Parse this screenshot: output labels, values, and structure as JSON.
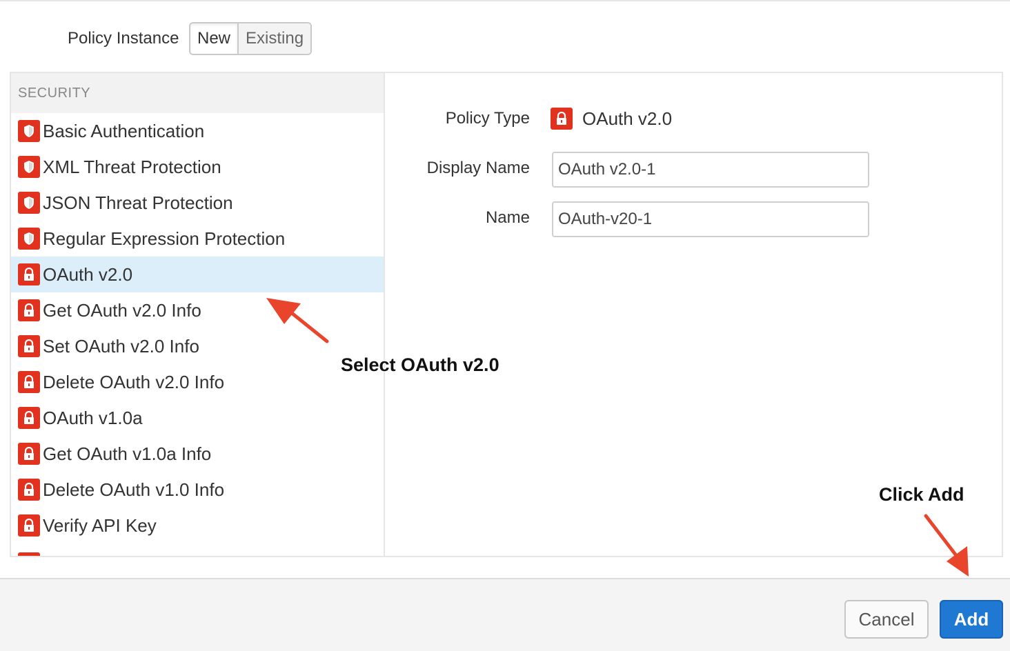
{
  "policy_instance": {
    "label": "Policy Instance",
    "options": [
      "New",
      "Existing"
    ],
    "selected": "New"
  },
  "policy_list": {
    "section_header": "SECURITY",
    "items": [
      {
        "label": "Basic Authentication",
        "icon": "shield-icon"
      },
      {
        "label": "XML Threat Protection",
        "icon": "shield-icon"
      },
      {
        "label": "JSON Threat Protection",
        "icon": "shield-icon"
      },
      {
        "label": "Regular Expression Protection",
        "icon": "shield-icon"
      },
      {
        "label": "OAuth v2.0",
        "icon": "lock-icon",
        "selected": true
      },
      {
        "label": "Get OAuth v2.0 Info",
        "icon": "lock-icon"
      },
      {
        "label": "Set OAuth v2.0 Info",
        "icon": "lock-icon"
      },
      {
        "label": "Delete OAuth v2.0 Info",
        "icon": "lock-icon"
      },
      {
        "label": "OAuth v1.0a",
        "icon": "lock-icon"
      },
      {
        "label": "Get OAuth v1.0a Info",
        "icon": "lock-icon"
      },
      {
        "label": "Delete OAuth v1.0 Info",
        "icon": "lock-icon"
      },
      {
        "label": "Verify API Key",
        "icon": "lock-icon"
      }
    ]
  },
  "form": {
    "policy_type_label": "Policy Type",
    "policy_type_value": "OAuth v2.0",
    "display_name_label": "Display Name",
    "display_name_value": "OAuth v2.0-1",
    "name_label": "Name",
    "name_value": "OAuth-v20-1"
  },
  "footer": {
    "cancel_label": "Cancel",
    "add_label": "Add"
  },
  "annotations": {
    "select_text": "Select OAuth v2.0",
    "click_text": "Click Add",
    "arrow_color": "#e8452c"
  },
  "colors": {
    "icon_red": "#e0321f",
    "selected_row": "#dceefa",
    "primary_button": "#1f78d1"
  }
}
